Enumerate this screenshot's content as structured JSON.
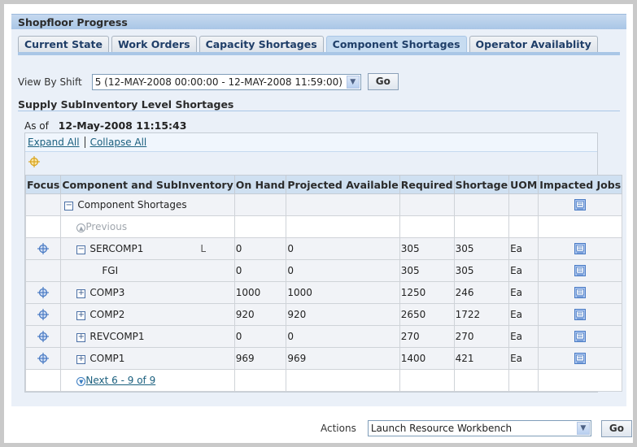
{
  "page": {
    "title": "Shopfloor Progress"
  },
  "tabs": [
    {
      "label": "Current State",
      "active": false
    },
    {
      "label": "Work Orders",
      "active": false
    },
    {
      "label": "Capacity Shortages",
      "active": false
    },
    {
      "label": "Component Shortages",
      "active": true
    },
    {
      "label": "Operator Availablity",
      "active": false
    }
  ],
  "shift_filter": {
    "label": "View By Shift",
    "selected": "5 (12-MAY-2008 00:00:00 - 12-MAY-2008 11:59:00)",
    "go_label": "Go"
  },
  "section": {
    "title": "Supply SubInventory Level Shortages",
    "as_of_label": "As of",
    "as_of_value": "12-May-2008 11:15:43"
  },
  "tree_controls": {
    "expand_all": "Expand All",
    "collapse_all": "Collapse All"
  },
  "table": {
    "columns": [
      "Focus",
      "Component and SubInventory",
      "On Hand",
      "Projected Available",
      "Required",
      "Shortage",
      "UOM",
      "Impacted Jobs"
    ],
    "root_label": "Component Shortages",
    "previous_label": "Previous",
    "rows": [
      {
        "name": "SERCOMP1",
        "toggle": "minus",
        "indent": 1,
        "focus": true,
        "on_hand": "0",
        "projected_available": "0",
        "required": "305",
        "shortage": "305",
        "uom": "Ea",
        "stray_mark": "L"
      },
      {
        "name": "FGI",
        "toggle": "none",
        "indent": 2,
        "focus": false,
        "on_hand": "0",
        "projected_available": "0",
        "required": "305",
        "shortage": "305",
        "uom": "Ea"
      },
      {
        "name": "COMP3",
        "toggle": "plus",
        "indent": 1,
        "focus": true,
        "on_hand": "1000",
        "projected_available": "1000",
        "required": "1250",
        "shortage": "246",
        "uom": "Ea"
      },
      {
        "name": "COMP2",
        "toggle": "plus",
        "indent": 1,
        "focus": true,
        "on_hand": "920",
        "projected_available": "920",
        "required": "2650",
        "shortage": "1722",
        "uom": "Ea"
      },
      {
        "name": "REVCOMP1",
        "toggle": "plus",
        "indent": 1,
        "focus": true,
        "on_hand": "0",
        "projected_available": "0",
        "required": "270",
        "shortage": "270",
        "uom": "Ea"
      },
      {
        "name": "COMP1",
        "toggle": "plus",
        "indent": 1,
        "focus": true,
        "on_hand": "969",
        "projected_available": "969",
        "required": "1400",
        "shortage": "421",
        "uom": "Ea"
      }
    ],
    "next_label": "Next 6 - 9 of 9"
  },
  "actions": {
    "label": "Actions",
    "selected": "Launch Resource Workbench",
    "go_label": "Go"
  },
  "colors": {
    "header_blue": "#a9c6e6",
    "content_bg": "#eaf0f8",
    "link": "#1a5f7e",
    "tab_text": "#1f3e68",
    "focus_icon_gold": "#d9a520",
    "focus_icon_blue": "#4a7bc4"
  }
}
